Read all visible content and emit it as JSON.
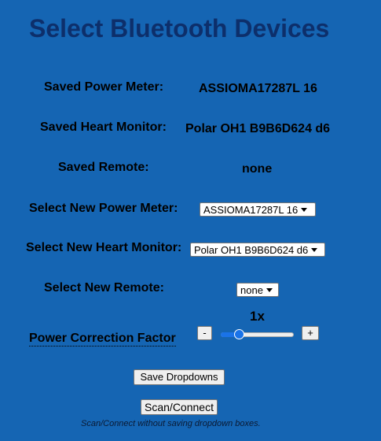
{
  "title": "Select Bluetooth Devices",
  "saved": {
    "power_meter_label": "Saved Power Meter:",
    "power_meter_value": "ASSIOMA17287L 16",
    "heart_monitor_label": "Saved Heart Monitor:",
    "heart_monitor_value": "Polar OH1 B9B6D624 d6",
    "remote_label": "Saved Remote:",
    "remote_value": "none"
  },
  "select": {
    "power_meter_label": "Select New Power Meter:",
    "power_meter_selected": "ASSIOMA17287L 16",
    "heart_monitor_label": "Select New Heart Monitor:",
    "heart_monitor_selected": "Polar OH1 B9B6D624 d6",
    "remote_label": "Select New Remote:",
    "remote_selected": "none"
  },
  "power_correction": {
    "label": "Power Correction Factor",
    "value_display": "1x",
    "decrement_label": "-",
    "increment_label": "+",
    "slider_fraction": 0.25
  },
  "buttons": {
    "save_label": "Save Dropdowns",
    "scan_label": "Scan/Connect"
  },
  "note": "Scan/Connect without saving dropdown boxes."
}
